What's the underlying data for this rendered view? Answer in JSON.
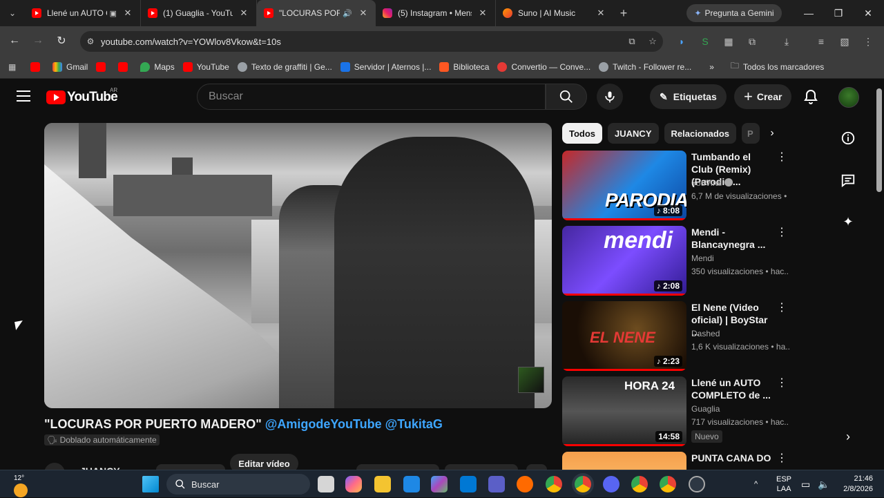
{
  "browser": {
    "tabs": [
      {
        "title": "Llené un AUTO C",
        "icon": "youtube-icon",
        "active": false,
        "extra": "cast-icon"
      },
      {
        "title": "(1) Guaglia - YouTube",
        "icon": "youtube-icon",
        "active": false
      },
      {
        "title": "\"LOCURAS POR P",
        "icon": "youtube-icon",
        "active": true,
        "extra": "speaker-icon"
      },
      {
        "title": "(5) Instagram • Mens",
        "icon": "instagram-icon",
        "active": false
      },
      {
        "title": "Suno | AI Music",
        "icon": "suno-icon",
        "active": false
      }
    ],
    "gemini_label": "Pregunta a Gemini",
    "url": "youtube.com/watch?v=YOWlov8Vkow&t=10s",
    "bookmarks": [
      {
        "label": "",
        "icon": "youtube"
      },
      {
        "label": "Gmail",
        "icon": "gmail"
      },
      {
        "label": "",
        "icon": "youtube"
      },
      {
        "label": "",
        "icon": "youtube"
      },
      {
        "label": "Maps",
        "icon": "maps"
      },
      {
        "label": "YouTube",
        "icon": "youtube"
      },
      {
        "label": "Texto de graffiti | Ge...",
        "icon": "globe"
      },
      {
        "label": "Servidor | Aternos |...",
        "icon": "server"
      },
      {
        "label": "Biblioteca",
        "icon": "library"
      },
      {
        "label": "Convertio — Conve...",
        "icon": "convertio"
      },
      {
        "label": "Twitch - Follower re...",
        "icon": "globe"
      }
    ],
    "bookmarks_more": "»",
    "all_bookmarks": "Todos los marcadores"
  },
  "youtube": {
    "logo_text": "YouTube",
    "country": "AR",
    "search_placeholder": "Buscar",
    "tags_label": "Etiquetas",
    "create_label": "Crear",
    "video_title": "\"LOCURAS POR PUERTO MADERO\"",
    "mentions": "@AmigodeYouTube @TukitaG",
    "dubbed": "Doblado automáticamente",
    "edit_label": "Editar vídeo",
    "channel_partial": "JUANCY",
    "chips": [
      "Todos",
      "JUANCY",
      "Relacionados",
      "P"
    ],
    "recommendations": [
      {
        "title": "Tumbando el Club (Remix) (Parodia ...",
        "channel": "YouViral",
        "verified": true,
        "meta": "6,7 M de visualizaciones • h",
        "duration": "8:08",
        "thumb_text": "PARODIA"
      },
      {
        "title": "Mendi - Blancaynegra ...",
        "channel": "Mendi",
        "verified": false,
        "meta": "350 visualizaciones • hac...",
        "duration": "2:08",
        "thumb_text": "mendi"
      },
      {
        "title": "El Nene (Video oficial) | BoyStar ...",
        "channel": "Dashed",
        "verified": false,
        "meta": "1,6 K visualizaciones • ha...",
        "duration": "2:23",
        "thumb_text": "EL NENE"
      },
      {
        "title": "Llené un AUTO COMPLETO de ...",
        "channel": "Guaglia",
        "verified": false,
        "meta": "717 visualizaciones • hac...",
        "duration": "14:58",
        "thumb_text": "HORA 24",
        "badge": "Nuevo"
      },
      {
        "title": "PUNTA CANA DO - ...",
        "channel": "",
        "verified": false,
        "meta": "",
        "duration": "",
        "thumb_text": ""
      }
    ]
  },
  "taskbar": {
    "temperature": "12°",
    "search_label": "Buscar",
    "lang_top": "ESP",
    "lang_bottom": "LAA",
    "time": "21:46",
    "date": "2/8/2026"
  }
}
